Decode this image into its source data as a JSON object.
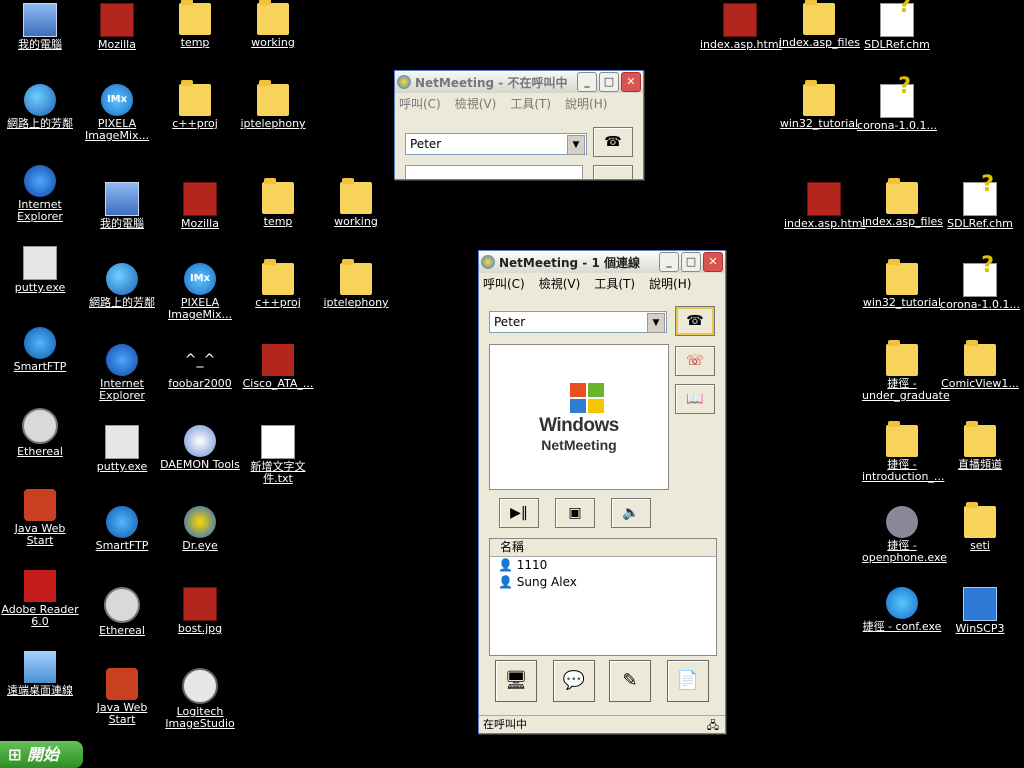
{
  "desktop": {
    "icons": [
      {
        "label": "我的電腦",
        "icon": "my-computer-icon"
      },
      {
        "label": "網路上的芳鄰",
        "icon": "network-places-icon"
      },
      {
        "label": "Internet Explorer",
        "icon": "internet-explorer-icon"
      },
      {
        "label": "putty.exe",
        "icon": "putty-icon"
      },
      {
        "label": "SmartFTP",
        "icon": "smartftp-icon"
      },
      {
        "label": "Ethereal",
        "icon": "ethereal-icon"
      },
      {
        "label": "Java Web Start",
        "icon": "java-icon"
      },
      {
        "label": "Adobe Reader 6.0",
        "icon": "adobe-reader-icon"
      },
      {
        "label": "遠端桌面連線",
        "icon": "remote-desktop-icon"
      },
      {
        "label": "Mozilla",
        "icon": "mozilla-icon"
      },
      {
        "label": "PIXELA ImageMix...",
        "icon": "imagemix-icon"
      },
      {
        "label": "我的電腦",
        "icon": "my-computer-icon"
      },
      {
        "label": "網路上的芳鄰",
        "icon": "network-places-icon"
      },
      {
        "label": "Internet Explorer",
        "icon": "internet-explorer-icon"
      },
      {
        "label": "putty.exe",
        "icon": "putty-icon"
      },
      {
        "label": "SmartFTP",
        "icon": "smartftp-icon"
      },
      {
        "label": "Ethereal",
        "icon": "ethereal-icon"
      },
      {
        "label": "Java Web Start",
        "icon": "java-icon"
      },
      {
        "label": "temp",
        "icon": "folder-icon"
      },
      {
        "label": "c++proj",
        "icon": "folder-icon"
      },
      {
        "label": "Mozilla",
        "icon": "mozilla-icon"
      },
      {
        "label": "PIXELA ImageMix...",
        "icon": "imagemix-icon"
      },
      {
        "label": "foobar2000",
        "icon": "foobar-icon"
      },
      {
        "label": "DAEMON Tools",
        "icon": "daemon-tools-icon"
      },
      {
        "label": "Dr.eye",
        "icon": "dreye-icon"
      },
      {
        "label": "bost.jpg",
        "icon": "image-file-icon"
      },
      {
        "label": "Logitech ImageStudio",
        "icon": "webcam-icon"
      },
      {
        "label": "working",
        "icon": "folder-icon"
      },
      {
        "label": "iptelephony",
        "icon": "folder-icon"
      },
      {
        "label": "temp",
        "icon": "folder-icon"
      },
      {
        "label": "c++proj",
        "icon": "folder-icon"
      },
      {
        "label": "Cisco_ATA_...",
        "icon": "cisco-icon"
      },
      {
        "label": "新增文字文件.txt",
        "icon": "text-file-icon"
      },
      {
        "label": "working",
        "icon": "folder-icon"
      },
      {
        "label": "iptelephony",
        "icon": "folder-icon"
      },
      {
        "label": "index.asp.html",
        "icon": "mozilla-icon"
      },
      {
        "label": "index.asp_files",
        "icon": "folder-icon"
      },
      {
        "label": "SDLRef.chm",
        "icon": "help-file-icon"
      },
      {
        "label": "win32_tutorial",
        "icon": "folder-icon"
      },
      {
        "label": "corona-1.0.1...",
        "icon": "help-file-icon"
      },
      {
        "label": "index.asp.html",
        "icon": "mozilla-icon"
      },
      {
        "label": "index.asp_files",
        "icon": "folder-icon"
      },
      {
        "label": "SDLRef.chm",
        "icon": "help-file-icon"
      },
      {
        "label": "win32_tutorial",
        "icon": "folder-icon"
      },
      {
        "label": "corona-1.0.1...",
        "icon": "help-file-icon"
      },
      {
        "label": "捷徑 - under_graduate",
        "icon": "folder-shortcut-icon"
      },
      {
        "label": "ComicView1...",
        "icon": "folder-icon"
      },
      {
        "label": "捷徑 - introduction_...",
        "icon": "folder-shortcut-icon"
      },
      {
        "label": "直播頻道",
        "icon": "folder-icon"
      },
      {
        "label": "捷徑 - openphone.exe",
        "icon": "openphone-icon"
      },
      {
        "label": "seti",
        "icon": "folder-icon"
      },
      {
        "label": "捷徑 - conf.exe",
        "icon": "netmeeting-icon"
      },
      {
        "label": "WinSCP3",
        "icon": "winscp-icon"
      }
    ]
  },
  "back_window": {
    "title": "NetMeeting - 不在呼叫中",
    "menu": [
      "呼叫(C)",
      "檢視(V)",
      "工具(T)",
      "說明(H)"
    ],
    "address_value": "Peter"
  },
  "front_window": {
    "title": "NetMeeting - 1 個連線",
    "menu": [
      "呼叫(C)",
      "檢視(V)",
      "工具(T)",
      "說明(H)"
    ],
    "address_value": "Peter",
    "logo_line1": "Windows",
    "logo_line2": "NetMeeting",
    "participants_header": "名稱",
    "participants": [
      "1110",
      "Sung Alex"
    ],
    "status_text": "在呼叫中"
  },
  "taskbar": {
    "start_label": "開始"
  }
}
